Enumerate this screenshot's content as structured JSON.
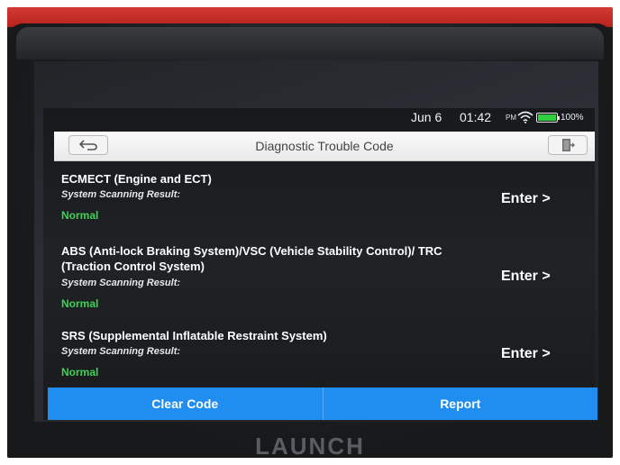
{
  "status_bar": {
    "date": "Jun 6",
    "time": "01:42",
    "ampm": "PM",
    "wifi_icon": "wifi-icon",
    "battery_icon": "battery-icon",
    "battery_percent": "100%",
    "battery_level": 1.0
  },
  "header": {
    "title": "Diagnostic Trouble Code",
    "back_icon": "back-arrow-icon",
    "exit_icon": "exit-icon"
  },
  "systems": [
    {
      "name": "ECMECT (Engine and ECT)",
      "result_label": "System Scanning Result:",
      "result_value": "Normal",
      "enter_label": "Enter >"
    },
    {
      "name": "ABS (Anti-lock Braking System)/VSC (Vehicle Stability Control)/ TRC (Traction Control System)",
      "result_label": "System Scanning Result:",
      "result_value": "Normal",
      "enter_label": "Enter >"
    },
    {
      "name": "SRS (Supplemental Inflatable Restraint System)",
      "result_label": "System Scanning Result:",
      "result_value": "Normal",
      "enter_label": "Enter >"
    }
  ],
  "footer": {
    "clear_code_label": "Clear Code",
    "report_label": "Report"
  },
  "device": {
    "brand": "LAUNCH"
  },
  "colors": {
    "accent_blue": "#1f8ef0",
    "status_green": "#3ed153",
    "case_red": "#c62d27"
  }
}
